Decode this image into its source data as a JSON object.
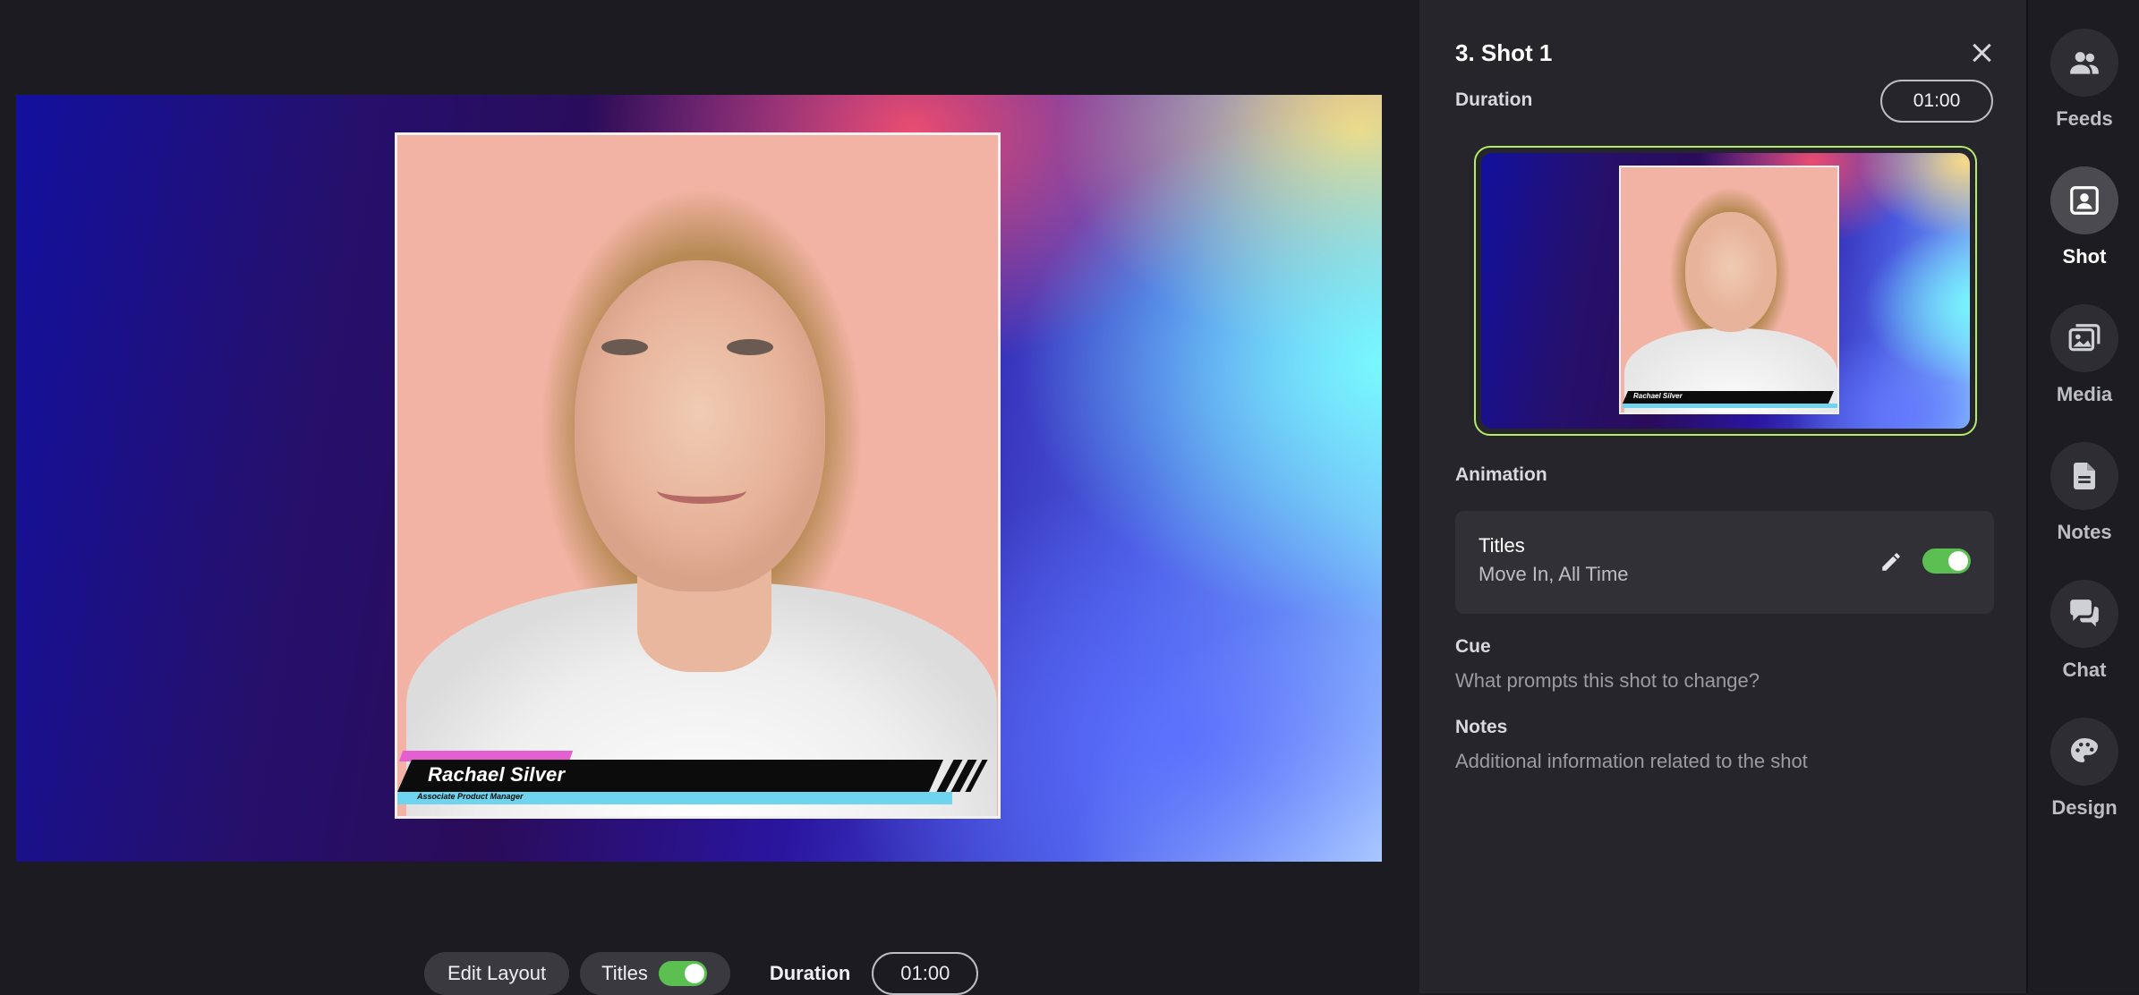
{
  "stage": {
    "lower_third": {
      "name": "Rachael Silver",
      "role": "Associate Product Manager"
    }
  },
  "toolbar": {
    "edit_layout_label": "Edit Layout",
    "titles_label": "Titles",
    "titles_on": true,
    "duration_label": "Duration",
    "duration_value": "01:00"
  },
  "panel": {
    "title": "3. Shot 1",
    "duration_label": "Duration",
    "duration_value": "01:00",
    "thumbnail_name": "Rachael Silver",
    "animation_label": "Animation",
    "animation_card": {
      "title": "Titles",
      "subtitle": "Move In, All Time",
      "enabled": true
    },
    "cue_label": "Cue",
    "cue_placeholder": "What prompts this shot to change?",
    "notes_label": "Notes",
    "notes_placeholder": "Additional information related to the shot"
  },
  "nav": {
    "items": [
      {
        "label": "Feeds",
        "icon": "people-icon",
        "active": false
      },
      {
        "label": "Shot",
        "icon": "portrait-icon",
        "active": true
      },
      {
        "label": "Media",
        "icon": "images-icon",
        "active": false
      },
      {
        "label": "Notes",
        "icon": "document-icon",
        "active": false
      },
      {
        "label": "Chat",
        "icon": "chat-bubbles-icon",
        "active": false
      },
      {
        "label": "Design",
        "icon": "palette-icon",
        "active": false
      }
    ]
  },
  "colors": {
    "accent_green": "#5bbf51",
    "thumbnail_border": "#b4ec6c",
    "panel_bg": "#26252b"
  }
}
